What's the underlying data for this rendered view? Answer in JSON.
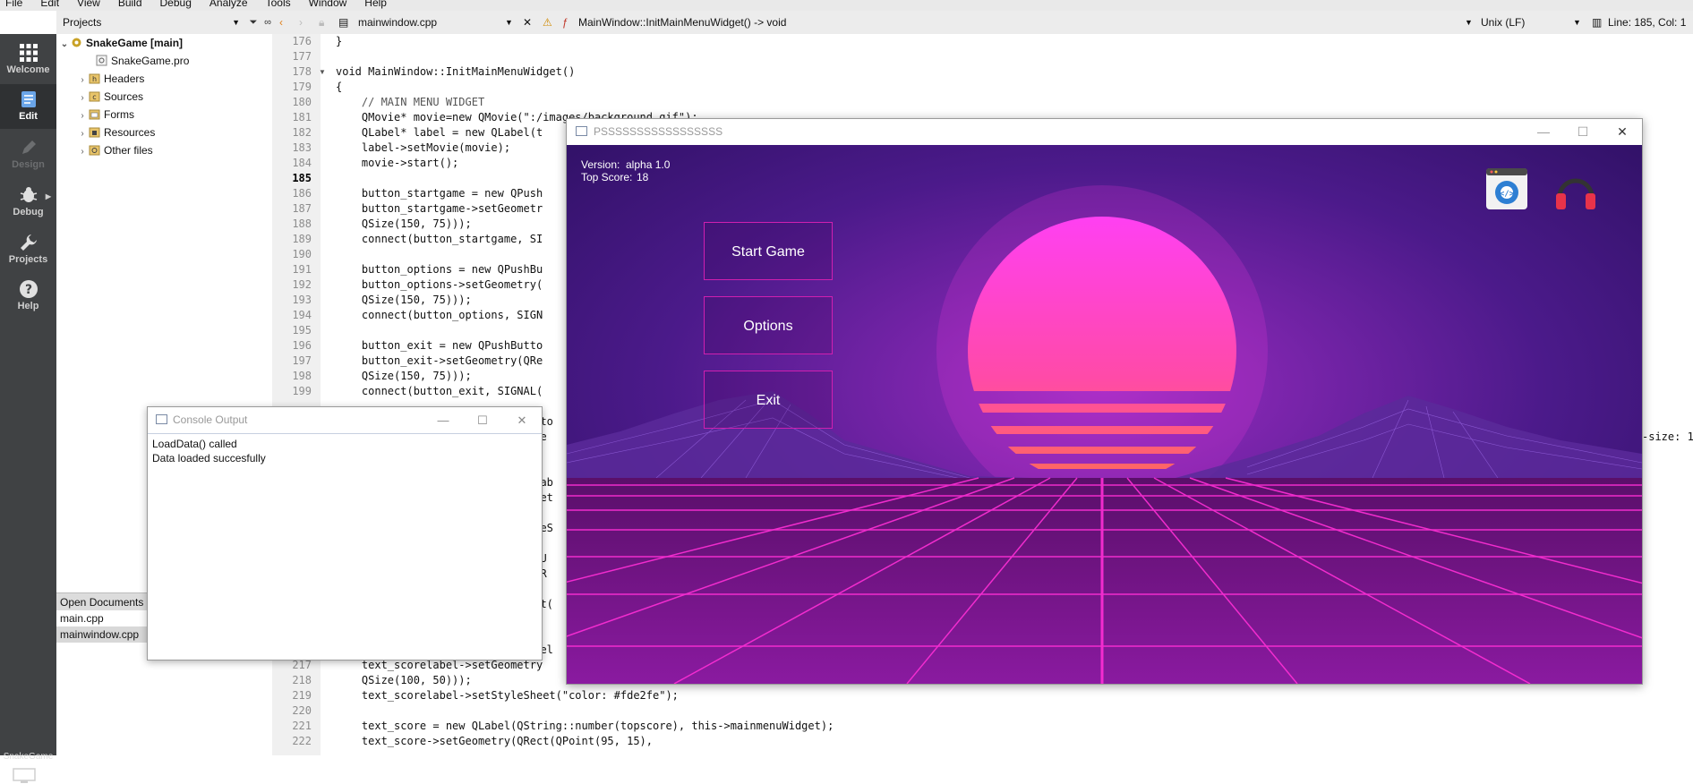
{
  "menu": [
    "File",
    "Edit",
    "View",
    "Build",
    "Debug",
    "Analyze",
    "Tools",
    "Window",
    "Help"
  ],
  "modes": [
    {
      "label": "Welcome",
      "icon": "grid-icon"
    },
    {
      "label": "Edit",
      "icon": "document-icon"
    },
    {
      "label": "Design",
      "icon": "pen-icon"
    },
    {
      "label": "Debug",
      "icon": "bug-icon"
    },
    {
      "label": "Projects",
      "icon": "wrench-icon"
    },
    {
      "label": "Help",
      "icon": "help-icon"
    }
  ],
  "kit_label": "SnakeGame",
  "projects": {
    "combo": "Projects",
    "tree": [
      {
        "label": "SnakeGame [main]",
        "expanded": true
      },
      {
        "label": "SnakeGame.pro"
      },
      {
        "label": "Headers"
      },
      {
        "label": "Sources"
      },
      {
        "label": "Forms"
      },
      {
        "label": "Resources"
      },
      {
        "label": "Other files"
      }
    ]
  },
  "open_documents": {
    "header": "Open Documents",
    "items": [
      "main.cpp",
      "mainwindow.cpp"
    ],
    "selected": "mainwindow.cpp"
  },
  "editor_toolbar": {
    "file": "mainwindow.cpp",
    "symbol": "MainWindow::InitMainMenuWidget() -> void",
    "encoding": "Unix (LF)",
    "position": "Line: 185, Col: 1"
  },
  "editor": {
    "current_line": "185",
    "lines": [
      {
        "n": "176",
        "t": "}"
      },
      {
        "n": "177",
        "t": ""
      },
      {
        "n": "178",
        "t": "void MainWindow::InitMainMenuWidget()"
      },
      {
        "n": "179",
        "t": "{"
      },
      {
        "n": "180",
        "t": "    // MAIN MENU WIDGET"
      },
      {
        "n": "181",
        "t": "    QMovie* movie=new QMovie(\":/images/background.gif\");"
      },
      {
        "n": "182",
        "t": "    QLabel* label = new QLabel(t"
      },
      {
        "n": "183",
        "t": "    label->setMovie(movie);"
      },
      {
        "n": "184",
        "t": "    movie->start();"
      },
      {
        "n": "185",
        "t": ""
      },
      {
        "n": "186",
        "t": "    button_startgame = new QPush"
      },
      {
        "n": "187",
        "t": "    button_startgame->setGeometr"
      },
      {
        "n": "188",
        "t": "    QSize(150, 75)));"
      },
      {
        "n": "189",
        "t": "    connect(button_startgame, SI"
      },
      {
        "n": "190",
        "t": ""
      },
      {
        "n": "191",
        "t": "    button_options = new QPushBu"
      },
      {
        "n": "192",
        "t": "    button_options->setGeometry("
      },
      {
        "n": "193",
        "t": "    QSize(150, 75)));"
      },
      {
        "n": "194",
        "t": "    connect(button_options, SIGN"
      },
      {
        "n": "195",
        "t": ""
      },
      {
        "n": "196",
        "t": "    button_exit = new QPushButto"
      },
      {
        "n": "197",
        "t": "    button_exit->setGeometry(QRe"
      },
      {
        "n": "198",
        "t": "    QSize(150, 75)));"
      },
      {
        "n": "199",
        "t": "    connect(button_exit, SIGNAL("
      },
      {
        "n": "217",
        "t": "    text_scorelabel->setGeometry"
      },
      {
        "n": "218",
        "t": "    QSize(100, 50)));"
      },
      {
        "n": "219",
        "t": "    text_scorelabel->setStyleSheet(\"color: #fde2fe\");"
      },
      {
        "n": "220",
        "t": ""
      },
      {
        "n": "221",
        "t": "    text_score = new QLabel(QString::number(topscore), this->mainmenuWidget);"
      },
      {
        "n": "222",
        "t": "    text_score->setGeometry(QRect(QPoint(95, 15),"
      }
    ],
    "fragments": [
      "utto",
      "hee",
      "QLab",
      "omet",
      "yleS",
      "(CU",
      "(QR",
      "eet(",
      "abel"
    ],
    "right_fragment": "-size: 1"
  },
  "game_window": {
    "title": "PSSSSSSSSSSSSSSSSS",
    "version_label": "Version:",
    "version_value": "alpha 1.0",
    "score_label": "Top Score:",
    "score_value": "18",
    "buttons": [
      "Start Game",
      "Options",
      "Exit"
    ]
  },
  "console_window": {
    "title": "Console Output",
    "lines": [
      "LoadData() called",
      "Data loaded succesfully"
    ]
  }
}
